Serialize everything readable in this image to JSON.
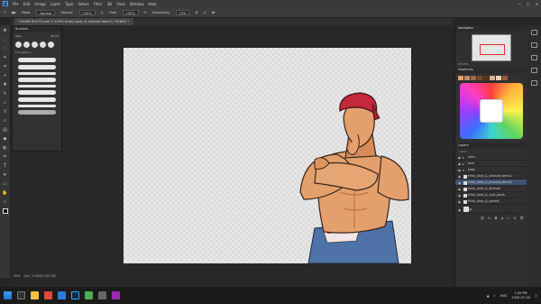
{
  "menu": {
    "items": [
      "File",
      "Edit",
      "Image",
      "Layer",
      "Type",
      "Select",
      "Filter",
      "3D",
      "View",
      "Window",
      "Help"
    ]
  },
  "options": {
    "mode_label": "Mode:",
    "mode_value": "Normal",
    "opacity_label": "Opacity:",
    "opacity_value": "100%",
    "flow_label": "Flow:",
    "flow_value": "100%",
    "smoothing_label": "Smoothing:",
    "smoothing_value": "10%"
  },
  "document": {
    "tab_title": "CHAR6 ROUTE part 3 100% (tribly body & dressed damn1, RGB/8) *"
  },
  "brushes": {
    "title": "Brushes",
    "size_label": "Size:",
    "size_value": "45 px",
    "folder_name": "brushes 1"
  },
  "status": {
    "zoom": "50%",
    "doc": "Doc: 12.6M/1,263.9M"
  },
  "navigator": {
    "title": "Navigator",
    "zoom": "33.33%"
  },
  "swatches": {
    "title": "Swatches"
  },
  "layers": {
    "title": "Layers",
    "kind_label": "Kind",
    "rows": [
      {
        "name": "arms",
        "selected": false
      },
      {
        "name": "face",
        "selected": false
      },
      {
        "name": "body",
        "selected": false
      },
      {
        "name": "tribly_body_&_dressed_damn1",
        "selected": false
      },
      {
        "name": "tribly_body_&_dressed_damn2",
        "selected": true
      },
      {
        "name": "tribly_body_&_dressed",
        "selected": false
      },
      {
        "name": "tribly_body_&_coat_pants",
        "selected": false
      },
      {
        "name": "tribly_body_&_sweats",
        "selected": false
      },
      {
        "name": "bg",
        "selected": false
      }
    ]
  },
  "taskbar": {
    "time": "2:45 PM",
    "date": "2020-07-16",
    "lang": "ENG"
  },
  "colors": {
    "accent": "#31a8ff",
    "bandana": "#c5283a",
    "skin": "#e3a06d",
    "skin_shadow": "#b96b3f",
    "jeans": "#4d73a8",
    "selected_layer": "#3f5473"
  }
}
